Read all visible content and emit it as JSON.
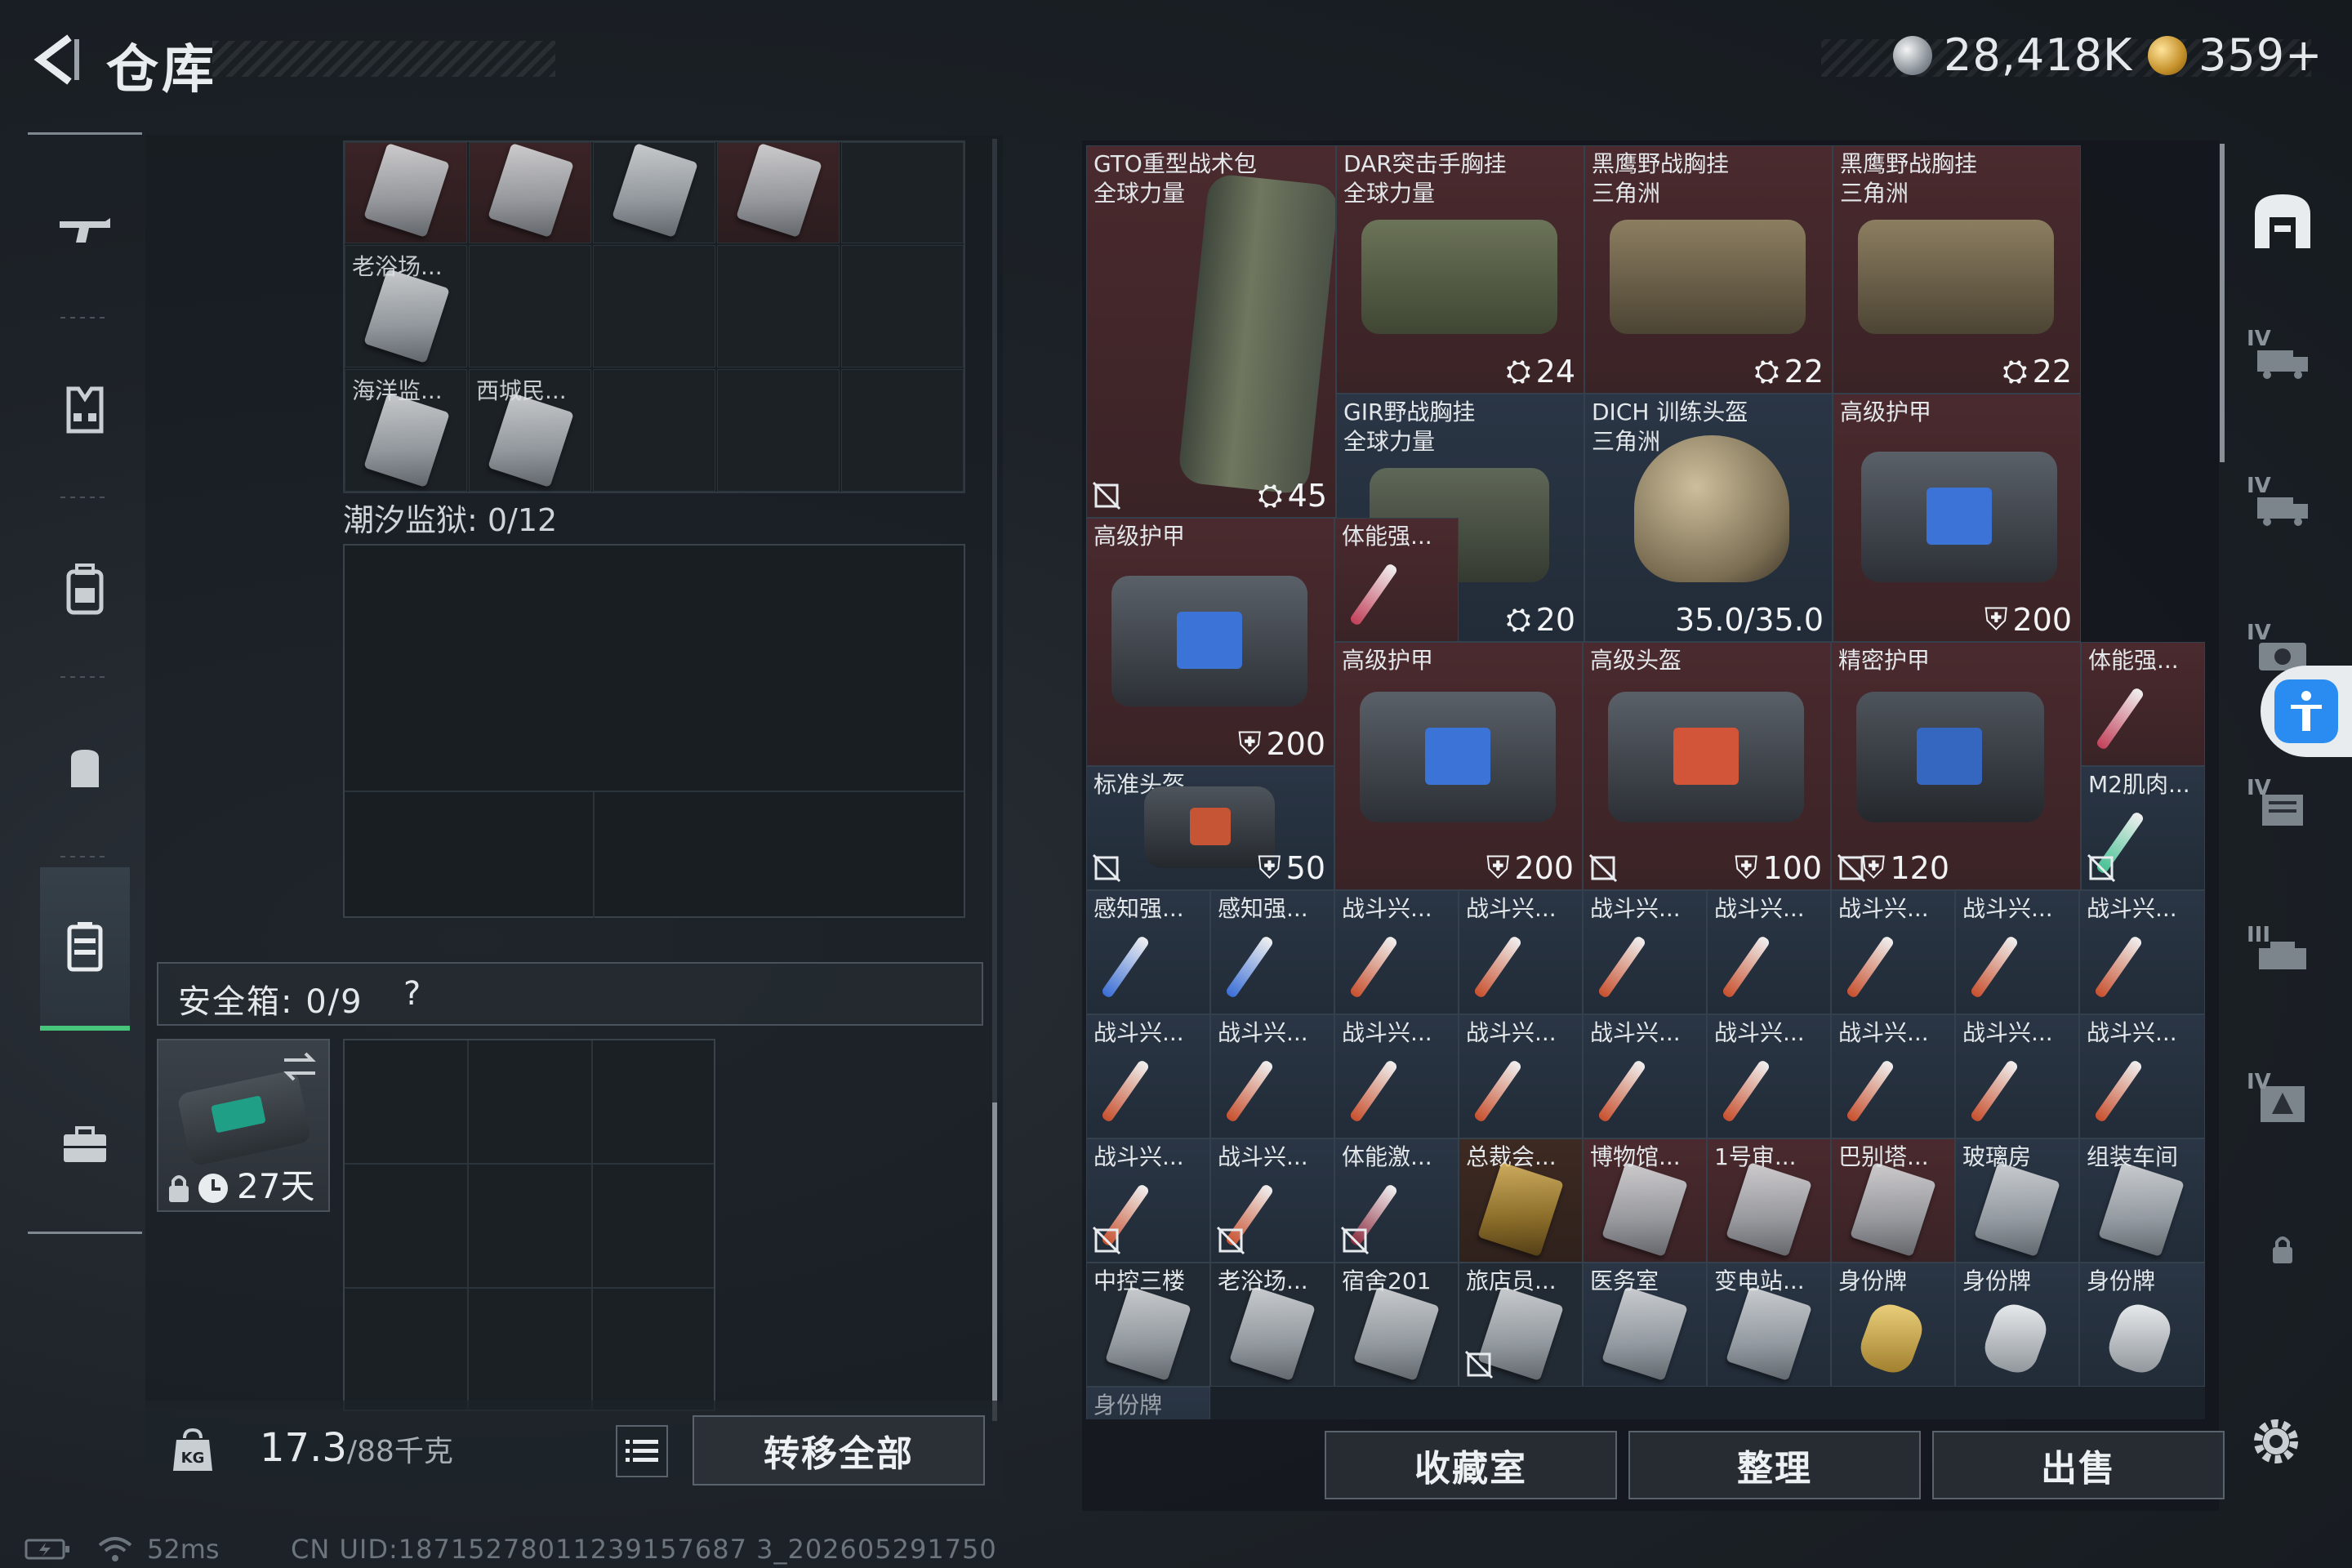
{
  "header": {
    "title": "仓库",
    "currency_silver": "28,418K",
    "currency_gold": "359+"
  },
  "left_rail": {
    "items": [
      "rifle-icon",
      "vest-icon",
      "backpack-icon",
      "pouch-icon",
      "case-icon",
      "briefcase-icon"
    ],
    "active_index": 4
  },
  "stash": {
    "top_cells": [
      "老浴场...",
      "海洋监...",
      "西城民..."
    ],
    "prison_label": "潮汐监狱: 0/12",
    "safebox_label": "安全箱: 0/9",
    "safebox_help": "?",
    "safebox_item_days": "27天",
    "weight_current": "17.3",
    "weight_max": "/88千克",
    "transfer_all": "转移全部"
  },
  "status": {
    "ping": "52ms",
    "uid": "CN UID:18715278011239157687 3_202605291750"
  },
  "inventory": {
    "items": [
      {
        "label": "GTO重型战术包\n全球力量",
        "badge": "45"
      },
      {
        "label": "DAR突击手胸挂\n全球力量",
        "badge": "24"
      },
      {
        "label": "黑鹰野战胸挂\n三角洲",
        "badge": "22"
      },
      {
        "label": "黑鹰野战胸挂\n三角洲",
        "badge": "22"
      },
      {
        "label": "GIR野战胸挂\n全球力量",
        "badge": "20"
      },
      {
        "label": "DICH 训练头盔\n三角洲",
        "badge": "35.0/35.0"
      },
      {
        "label": "高级护甲",
        "badge": "200"
      },
      {
        "label": "高级护甲",
        "badge": "200"
      },
      {
        "label": "体能强...",
        "badge": ""
      },
      {
        "label": "高级护甲",
        "badge": "200"
      },
      {
        "label": "高级头盔",
        "badge": "100"
      },
      {
        "label": "精密护甲",
        "badge": "120"
      },
      {
        "label": "体能强...",
        "badge": ""
      },
      {
        "label": "标准头盔",
        "badge": "50"
      },
      {
        "label": "M2肌肉...",
        "badge": ""
      }
    ],
    "row1": [
      "感知强...",
      "感知强...",
      "战斗兴...",
      "战斗兴...",
      "战斗兴...",
      "战斗兴...",
      "战斗兴...",
      "战斗兴...",
      "战斗兴..."
    ],
    "row2": [
      "战斗兴...",
      "战斗兴...",
      "战斗兴...",
      "战斗兴...",
      "战斗兴...",
      "战斗兴...",
      "战斗兴...",
      "战斗兴...",
      "战斗兴..."
    ],
    "row3": [
      "战斗兴...",
      "战斗兴...",
      "体能激...",
      "总裁会...",
      "博物馆...",
      "1号审...",
      "巴别塔...",
      "玻璃房",
      "组装车间"
    ],
    "row4": [
      "中控三楼",
      "老浴场...",
      "宿舍201",
      "旅店员...",
      "医务室",
      "变电站...",
      "身份牌",
      "身份牌",
      "身份牌"
    ],
    "row5_first": "身份牌",
    "buttons": {
      "collection": "收藏室",
      "arrange": "整理",
      "sell": "出售"
    }
  },
  "right_rail": {
    "tiers": [
      "IV",
      "IV",
      "IV",
      "IV",
      "III",
      "IV"
    ]
  },
  "colors": {
    "accent_green": "#47c67b",
    "accent_blue": "#2a8cf0",
    "slot_red": "#4a2a2e",
    "slot_blue": "#2a3545"
  }
}
